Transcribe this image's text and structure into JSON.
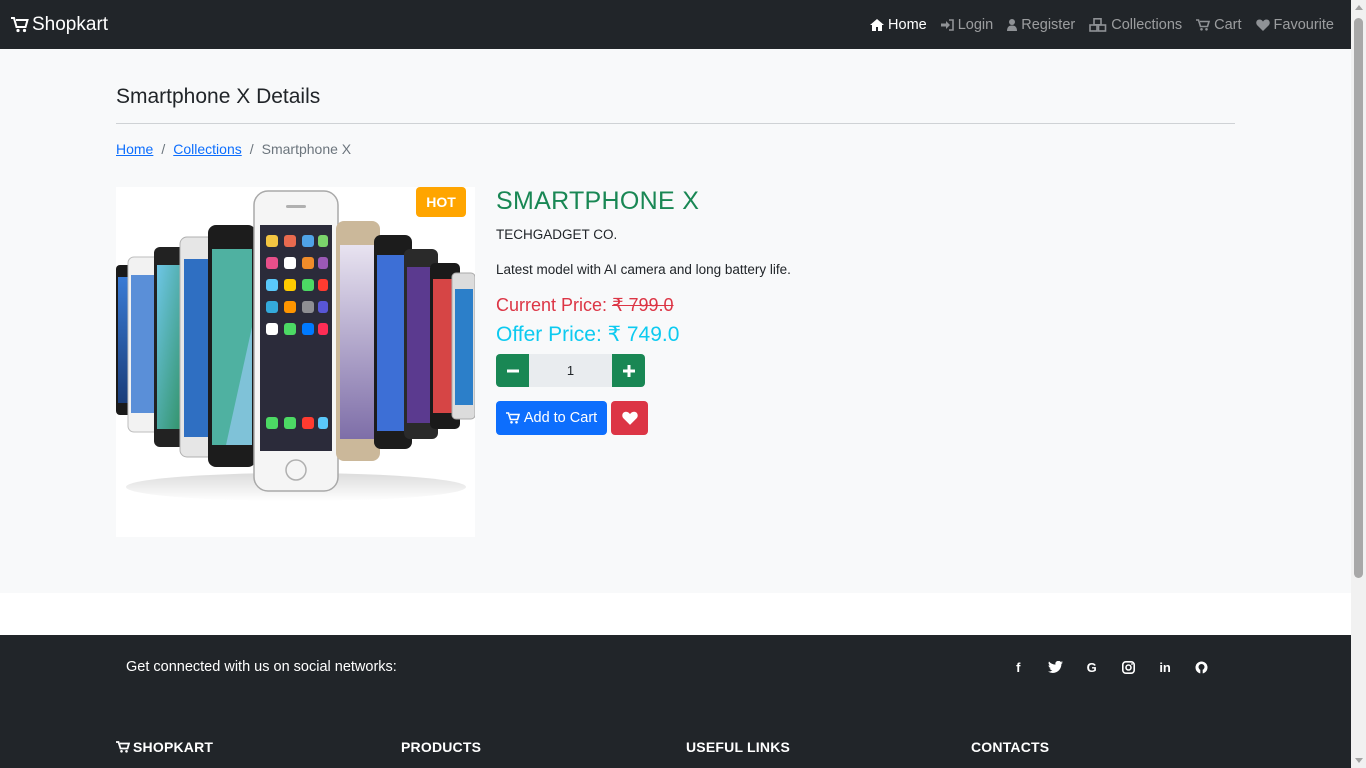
{
  "navbar": {
    "brand": "Shopkart",
    "links": [
      {
        "label": "Home",
        "icon": "home-icon"
      },
      {
        "label": "Login",
        "icon": "sign-in-icon"
      },
      {
        "label": "Register",
        "icon": "user-icon"
      },
      {
        "label": "Collections",
        "icon": "cubes-icon"
      },
      {
        "label": "Cart",
        "icon": "cart-icon"
      },
      {
        "label": "Favourite",
        "icon": "heart-icon"
      }
    ]
  },
  "page": {
    "title": "Smartphone X Details",
    "breadcrumb": [
      "Home",
      "Collections",
      "Smartphone X"
    ]
  },
  "product": {
    "badge": "HOT",
    "name": "SMARTPHONE X",
    "brand": "TECHGADGET CO.",
    "description": "Latest model with AI camera and long battery life.",
    "current_price_label": "Current Price:",
    "current_price": "₹ 799.0",
    "offer_price_label": "Offer Price:",
    "offer_price": "₹ 749.0",
    "quantity": "1",
    "add_to_cart_label": "Add to Cart"
  },
  "footer": {
    "social_text": "Get connected with us on social networks:",
    "social_icons": [
      "facebook-icon",
      "twitter-icon",
      "google-icon",
      "instagram-icon",
      "linkedin-icon",
      "github-icon"
    ],
    "columns": [
      "SHOPKART",
      "PRODUCTS",
      "USEFUL LINKS",
      "CONTACTS"
    ]
  },
  "colors": {
    "navbar_bg": "#212529",
    "accent_green": "#198754",
    "price_red": "#dc3545",
    "offer_cyan": "#0dcaf0",
    "primary_blue": "#0d6efd",
    "badge_orange": "#ffa500"
  }
}
